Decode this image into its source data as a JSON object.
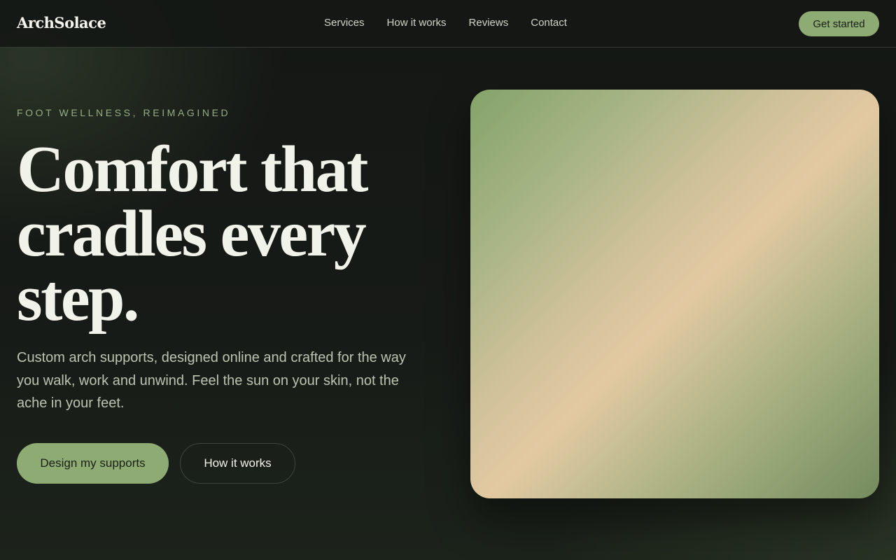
{
  "brand": {
    "name": "ArchSolace"
  },
  "nav": {
    "items": [
      {
        "label": "Services"
      },
      {
        "label": "How it works"
      },
      {
        "label": "Reviews"
      },
      {
        "label": "Contact"
      }
    ],
    "cta_label": "Get started"
  },
  "hero": {
    "eyebrow": "FOOT WELLNESS, REIMAGINED",
    "title": "Comfort that cradles every step.",
    "subtitle": "Custom arch supports, designed online and crafted for the way you walk, work and unwind. Feel the sun on your skin, not the ache in your feet.",
    "primary_cta": "Design my supports",
    "secondary_cta": "How it works"
  },
  "colors": {
    "accent": "#8fab74",
    "background": "#151816",
    "heading": "#f1f3ea",
    "muted_text": "#bcc3b2"
  }
}
